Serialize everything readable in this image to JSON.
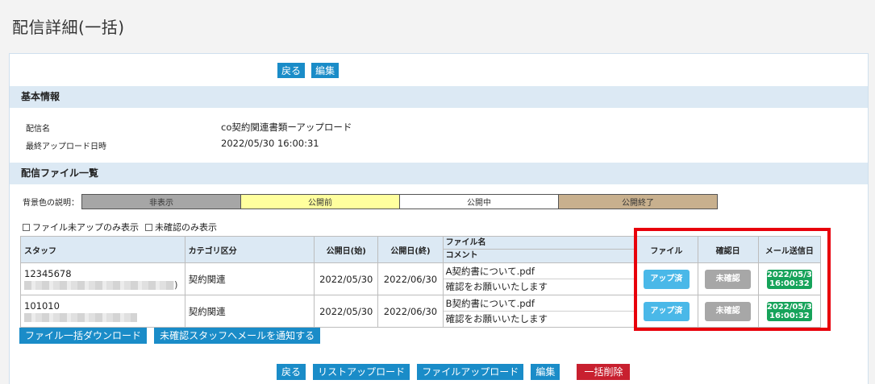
{
  "page": {
    "title": "配信詳細(一括)"
  },
  "top_buttons": {
    "back": "戻る",
    "edit": "編集"
  },
  "basic_info": {
    "heading": "基本情報",
    "fields": [
      {
        "label": "配信名",
        "value": "co契約関連書類ーアップロード"
      },
      {
        "label": "最終アップロード日時",
        "value": "2022/05/30 16:00:31"
      }
    ]
  },
  "file_list": {
    "heading": "配信ファイル一覧",
    "legend": {
      "label": "背景色の説明：",
      "items": [
        {
          "text": "非表示",
          "color": "#a6a6a6"
        },
        {
          "text": "公開前",
          "color": "#ffff9e"
        },
        {
          "text": "公開中",
          "color": "#ffffff"
        },
        {
          "text": "公開終了",
          "color": "#c8b08e"
        }
      ]
    },
    "filters": [
      {
        "label": "ファイル未アップのみ表示"
      },
      {
        "label": "未確認のみ表示"
      }
    ],
    "columns": {
      "staff": "スタッフ",
      "category": "カテゴリ区分",
      "open_start": "公開日(始)",
      "open_end": "公開日(終)",
      "file_name": "ファイル名",
      "comment": "コメント",
      "file": "ファイル",
      "confirm_date": "確認日",
      "mail_sent": "メール送信日"
    },
    "rows": [
      {
        "staff_id": "12345678",
        "staff_suffix": ")",
        "category": "契約関連",
        "open_start": "2022/05/30",
        "open_end": "2022/06/30",
        "file_name": "A契約書について.pdf",
        "comment": "確認をお願いいたします",
        "file_status": "アップ済",
        "confirm_status": "未確認",
        "mail_date": "2022/05/30",
        "mail_time": "16:00:32"
      },
      {
        "staff_id": "101010",
        "staff_suffix": "",
        "category": "契約関連",
        "open_start": "2022/05/30",
        "open_end": "2022/06/30",
        "file_name": "B契約書について.pdf",
        "comment": "確認をお願いいたします",
        "file_status": "アップ済",
        "confirm_status": "未確認",
        "mail_date": "2022/05/30",
        "mail_time": "16:00:32"
      }
    ]
  },
  "bulk_buttons": {
    "download_all": "ファイル一括ダウンロード",
    "notify_unconfirmed": "未確認スタッフへメールを通知する"
  },
  "bottom_buttons": {
    "back": "戻る",
    "list_upload": "リストアップロード",
    "file_upload": "ファイルアップロード",
    "edit": "編集",
    "delete_all": "一括削除"
  },
  "colors": {
    "primary_button": "#1a8cc8",
    "danger_button": "#c8202f",
    "section_header": "#dce9f4",
    "uploaded_badge": "#4ab8e8",
    "unconfirmed_badge": "#a7a7a7",
    "sent_badge": "#16a35a",
    "highlight_border": "#e8000b"
  }
}
